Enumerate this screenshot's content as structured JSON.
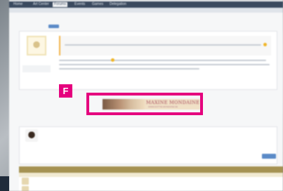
{
  "nav": {
    "tabs": [
      "Home",
      "Art Center",
      "Forums",
      "Events",
      "Games",
      "Delegation"
    ],
    "active_index": 2
  },
  "callout": {
    "label": "F"
  },
  "signature_banner": {
    "title": "MAXINE MONDAINE",
    "subtitle": "WWW.DOTTIE.MONDAINE.DE"
  },
  "colors": {
    "accent": "#e5007e",
    "nav_bg": "#3b4a5f",
    "link": "#5a8ac7",
    "similar_header": "#a59252"
  }
}
